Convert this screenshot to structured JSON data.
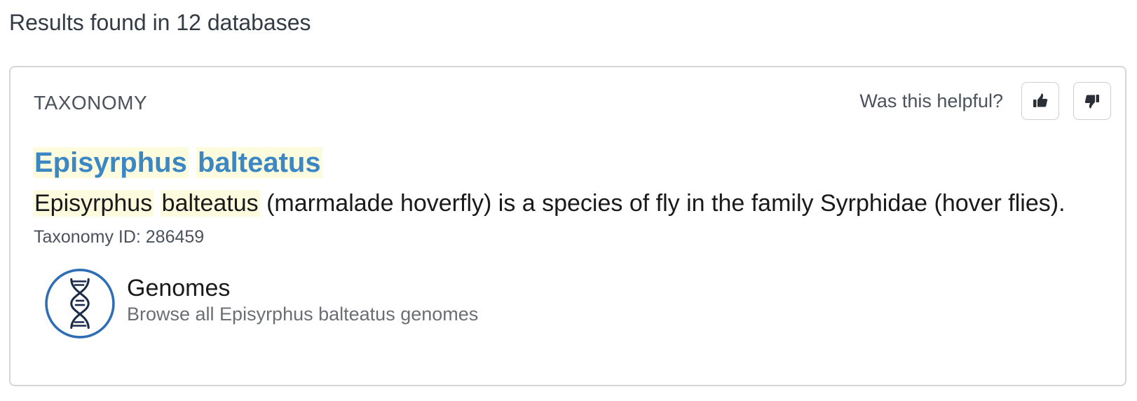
{
  "results_heading": "Results found in 12 databases",
  "card": {
    "category": "TAXONOMY",
    "feedback": {
      "prompt": "Was this helpful?",
      "thumbs_up_icon": "thumbs-up-icon",
      "thumbs_down_icon": "thumbs-down-icon"
    },
    "title": {
      "word1": "Episyrphus",
      "word2": "balteatus"
    },
    "description": {
      "highlight1": "Episyrphus",
      "highlight2": "balteatus",
      "rest": "(marmalade hoverfly) is a species of fly in the family Syrphidae (hover flies)."
    },
    "taxonomy_id": "Taxonomy ID: 286459",
    "genomes": {
      "icon": "dna-icon",
      "title": "Genomes",
      "subtitle": "Browse all Episyrphus balteatus genomes"
    }
  },
  "colors": {
    "link_blue": "#3a87c4",
    "highlight": "#fdfbde",
    "icon_ring": "#2f6db5",
    "icon_dna": "#1c2b4a",
    "border": "#d6d6d6"
  }
}
